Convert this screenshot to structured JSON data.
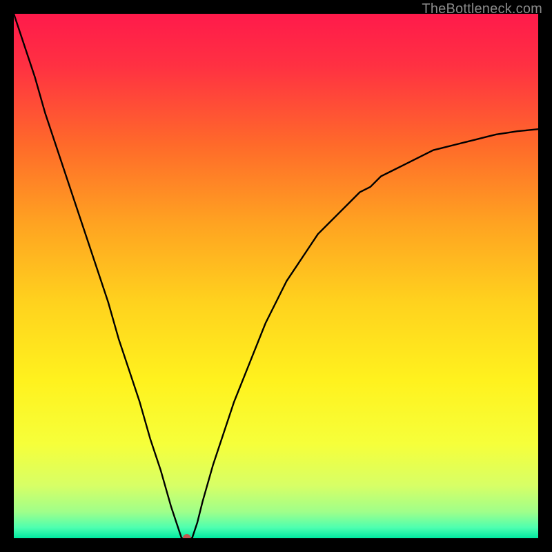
{
  "watermark": "TheBottleneck.com",
  "chart_data": {
    "type": "line",
    "title": "",
    "xlabel": "",
    "ylabel": "",
    "xlim": [
      0,
      100
    ],
    "ylim": [
      0,
      100
    ],
    "x": [
      0,
      2,
      4,
      6,
      8,
      10,
      12,
      14,
      16,
      18,
      20,
      22,
      24,
      26,
      28,
      30,
      31,
      32,
      33,
      34,
      35,
      36,
      38,
      40,
      42,
      44,
      46,
      48,
      50,
      52,
      54,
      56,
      58,
      60,
      62,
      64,
      66,
      68,
      70,
      72,
      74,
      76,
      78,
      80,
      82,
      84,
      86,
      88,
      90,
      92,
      94,
      96,
      98,
      100
    ],
    "values": [
      100,
      94,
      88,
      81,
      75,
      69,
      63,
      57,
      51,
      45,
      38,
      32,
      26,
      19,
      13,
      6,
      3,
      0,
      0,
      0,
      3,
      7,
      14,
      20,
      26,
      31,
      36,
      41,
      45,
      49,
      52,
      55,
      58,
      60,
      62,
      64,
      66,
      67,
      69,
      70,
      71,
      72,
      73,
      74,
      74.5,
      75,
      75.5,
      76,
      76.5,
      77,
      77.3,
      77.6,
      77.8,
      78
    ],
    "minimum_marker": {
      "x": 33,
      "y": 0
    },
    "background": "rainbow_vertical_gradient",
    "legend": null,
    "grid": false
  }
}
